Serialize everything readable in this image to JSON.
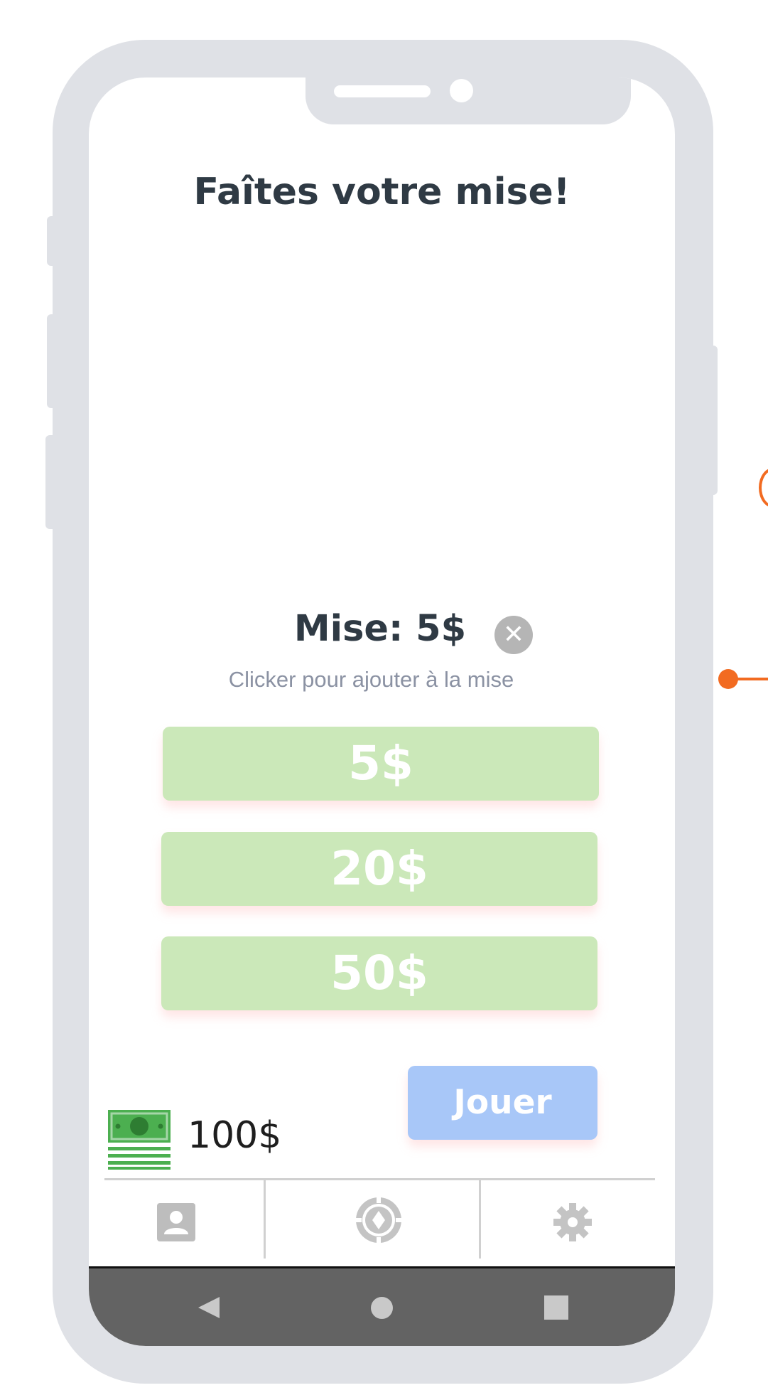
{
  "header": {
    "title": "Faîtes votre mise!"
  },
  "bet": {
    "label": "Mise: 5$",
    "clear_symbol": "✕",
    "hint": "Clicker pour ajouter à la mise",
    "options": [
      "5$",
      "20$",
      "50$"
    ]
  },
  "actions": {
    "play_label": "Jouer"
  },
  "wallet": {
    "balance": "100$",
    "icon": "money-stack-icon"
  },
  "tabs": [
    {
      "name": "profile",
      "icon": "user-card-icon"
    },
    {
      "name": "casino",
      "icon": "casino-chip-icon"
    },
    {
      "name": "settings",
      "icon": "gear-icon"
    }
  ],
  "system_nav": {
    "back": "back-triangle-icon",
    "home": "home-circle-icon",
    "recent": "recent-square-icon"
  },
  "colors": {
    "bet_button": "#cbe8b9",
    "play_button": "#a8c7f8",
    "title_text": "#2f3a44",
    "annotation": "#f26b21",
    "frame": "#dfe1e6"
  }
}
